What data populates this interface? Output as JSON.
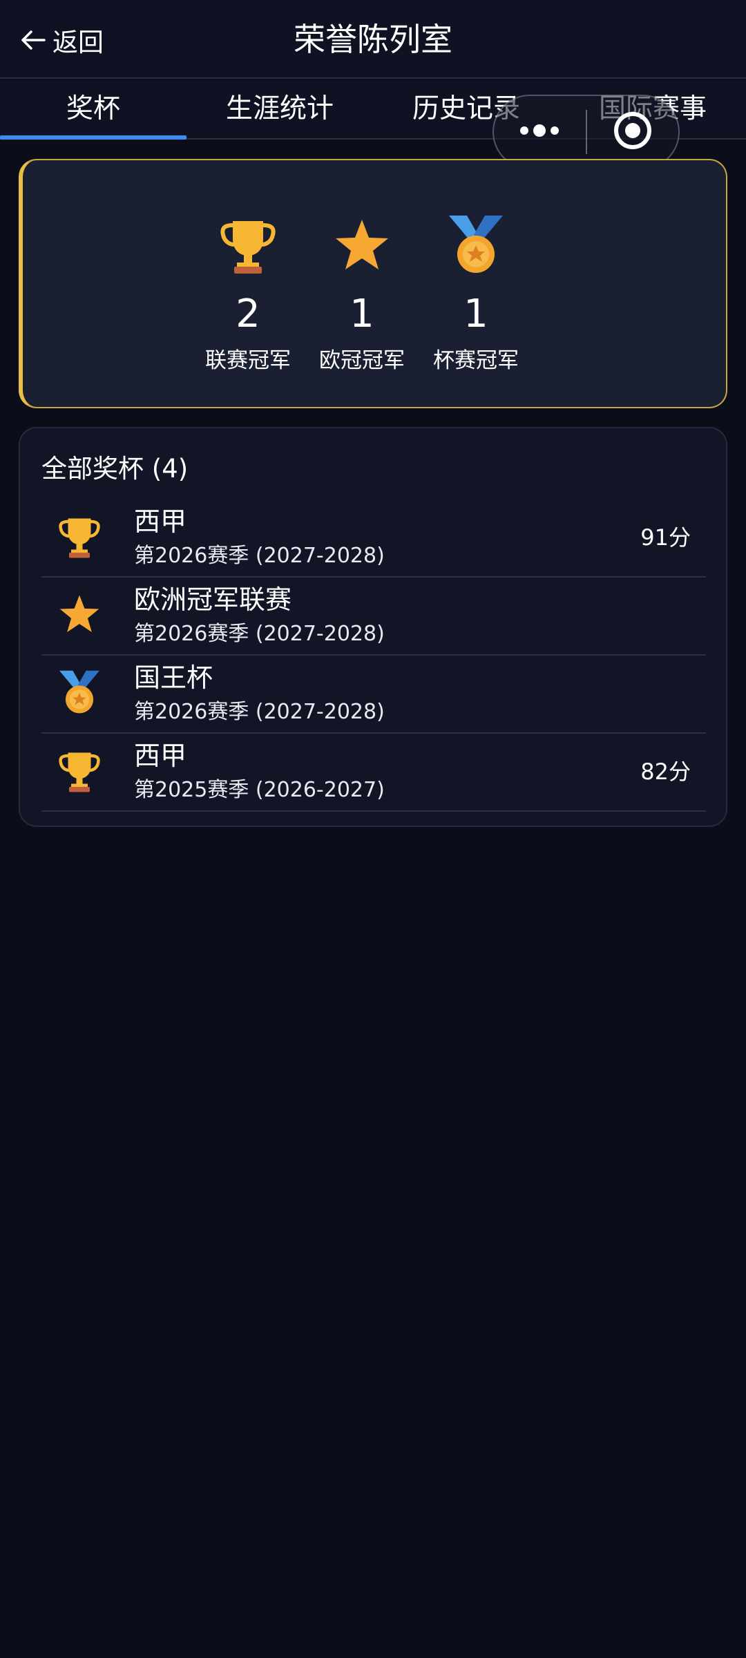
{
  "header": {
    "back_label": "返回",
    "title": "荣誉陈列室"
  },
  "tabs": [
    {
      "label": "奖杯",
      "active": true
    },
    {
      "label": "生涯统计",
      "active": false
    },
    {
      "label": "历史记录",
      "active": false
    },
    {
      "label": "国际赛事",
      "active": false
    }
  ],
  "summary": [
    {
      "icon": "trophy-icon",
      "count": "2",
      "label": "联赛冠军"
    },
    {
      "icon": "star-icon",
      "count": "1",
      "label": "欧冠冠军"
    },
    {
      "icon": "medal-icon",
      "count": "1",
      "label": "杯赛冠军"
    }
  ],
  "trophy_list": {
    "title": "全部奖杯 (4)",
    "items": [
      {
        "icon": "trophy-icon",
        "name": "西甲",
        "season": "第2026赛季 (2027-2028)",
        "points": "91分"
      },
      {
        "icon": "star-icon",
        "name": "欧洲冠军联赛",
        "season": "第2026赛季 (2027-2028)",
        "points": ""
      },
      {
        "icon": "medal-icon",
        "name": "国王杯",
        "season": "第2026赛季 (2027-2028)",
        "points": ""
      },
      {
        "icon": "trophy-icon",
        "name": "西甲",
        "season": "第2025赛季 (2026-2027)",
        "points": "82分"
      }
    ]
  },
  "colors": {
    "accent": "#3b8ef0",
    "gold_border": "#c9a63e",
    "background": "#0b0e19"
  }
}
